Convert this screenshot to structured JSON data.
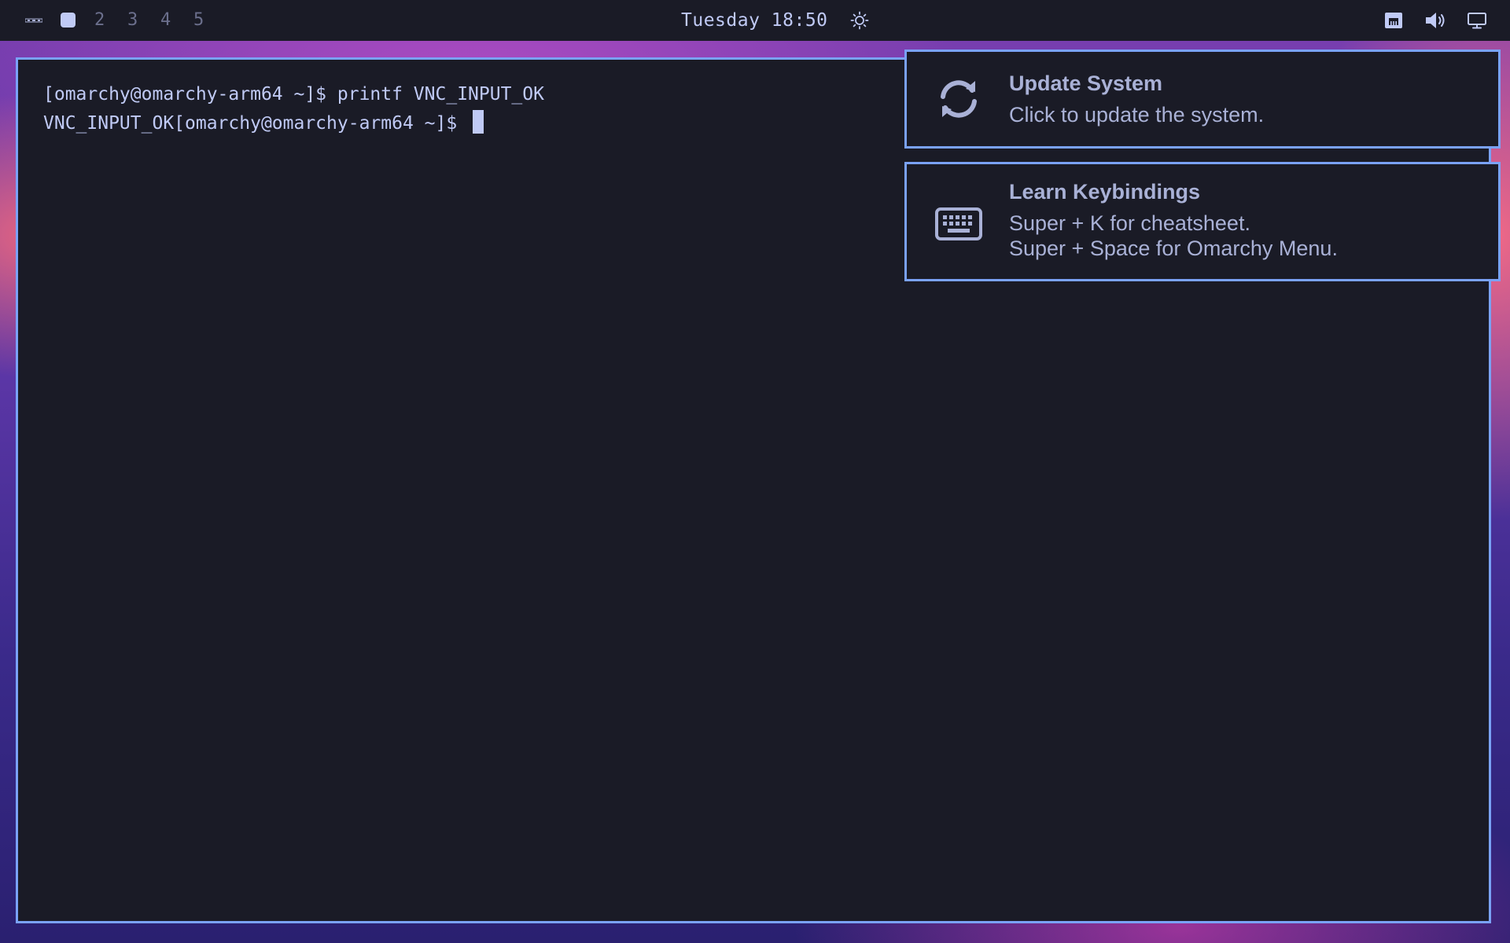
{
  "topbar": {
    "logo_icon": "omarchy-logo-icon",
    "workspaces": [
      "2",
      "3",
      "4",
      "5"
    ],
    "active_workspace_icon": "active-workspace-square-icon",
    "clock": "Tuesday 18:50",
    "tray_icons": [
      "weather-sun-icon",
      "network-ethernet-icon",
      "volume-icon",
      "display-icon"
    ]
  },
  "terminal": {
    "lines": [
      "[omarchy@omarchy-arm64 ~]$ printf VNC_INPUT_OK",
      "VNC_INPUT_OK[omarchy@omarchy-arm64 ~]$ "
    ]
  },
  "notifications": [
    {
      "icon": "refresh-icon",
      "title": "Update System",
      "body": [
        "Click to update the system."
      ]
    },
    {
      "icon": "keyboard-icon",
      "title": "Learn Keybindings",
      "body": [
        "Super + K for cheatsheet.",
        "Super + Space for Omarchy Menu."
      ]
    }
  ],
  "colors": {
    "accent": "#7aa2f7",
    "background": "#1a1b26",
    "foreground": "#c0caf5",
    "muted": "#6b6f8c"
  }
}
